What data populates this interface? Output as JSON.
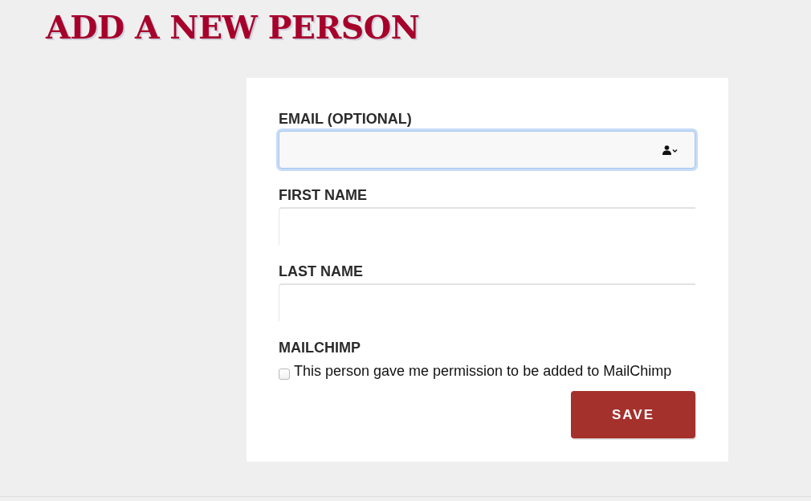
{
  "page_title": "ADD A NEW PERSON",
  "form": {
    "fields": [
      {
        "kind": "email",
        "label": "EMAIL (OPTIONAL)",
        "focused": true
      },
      {
        "kind": "text",
        "label": "FIRST NAME",
        "focused": false
      },
      {
        "kind": "text",
        "label": "LAST NAME",
        "focused": false
      }
    ],
    "mailchimp": {
      "label": "MAILCHIMP",
      "checkbox": {
        "label": "This person gave me permission to be added to MailChimp",
        "checked": false
      }
    },
    "save_button": "SAVE"
  }
}
